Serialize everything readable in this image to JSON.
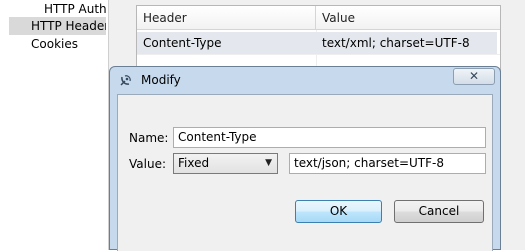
{
  "tree": {
    "items": [
      {
        "label": "HTTP Auth"
      },
      {
        "label": "HTTP Headers",
        "selected": true
      },
      {
        "label": "Cookies"
      }
    ]
  },
  "table": {
    "columns": [
      "Header",
      "Value"
    ],
    "rows": [
      {
        "header": "Content-Type",
        "value": "text/xml; charset=UTF-8"
      }
    ]
  },
  "dialog": {
    "title": "Modify",
    "close_label": "✕",
    "name_label": "Name:",
    "name_value": "Content-Type",
    "value_label": "Value:",
    "value_type": "Fixed",
    "value_text": "text/json; charset=UTF-8",
    "ok_label": "OK",
    "cancel_label": "Cancel"
  },
  "colors": {
    "selection": "#d9d9d9",
    "row_highlight": "#e4e8ee",
    "dialog_frame": "#c7d9ec",
    "ok_button": "#bee6fd"
  },
  "icons": {
    "dialog": "satellite-dish-icon",
    "close": "close-icon",
    "dropdown": "chevron-down-icon"
  }
}
